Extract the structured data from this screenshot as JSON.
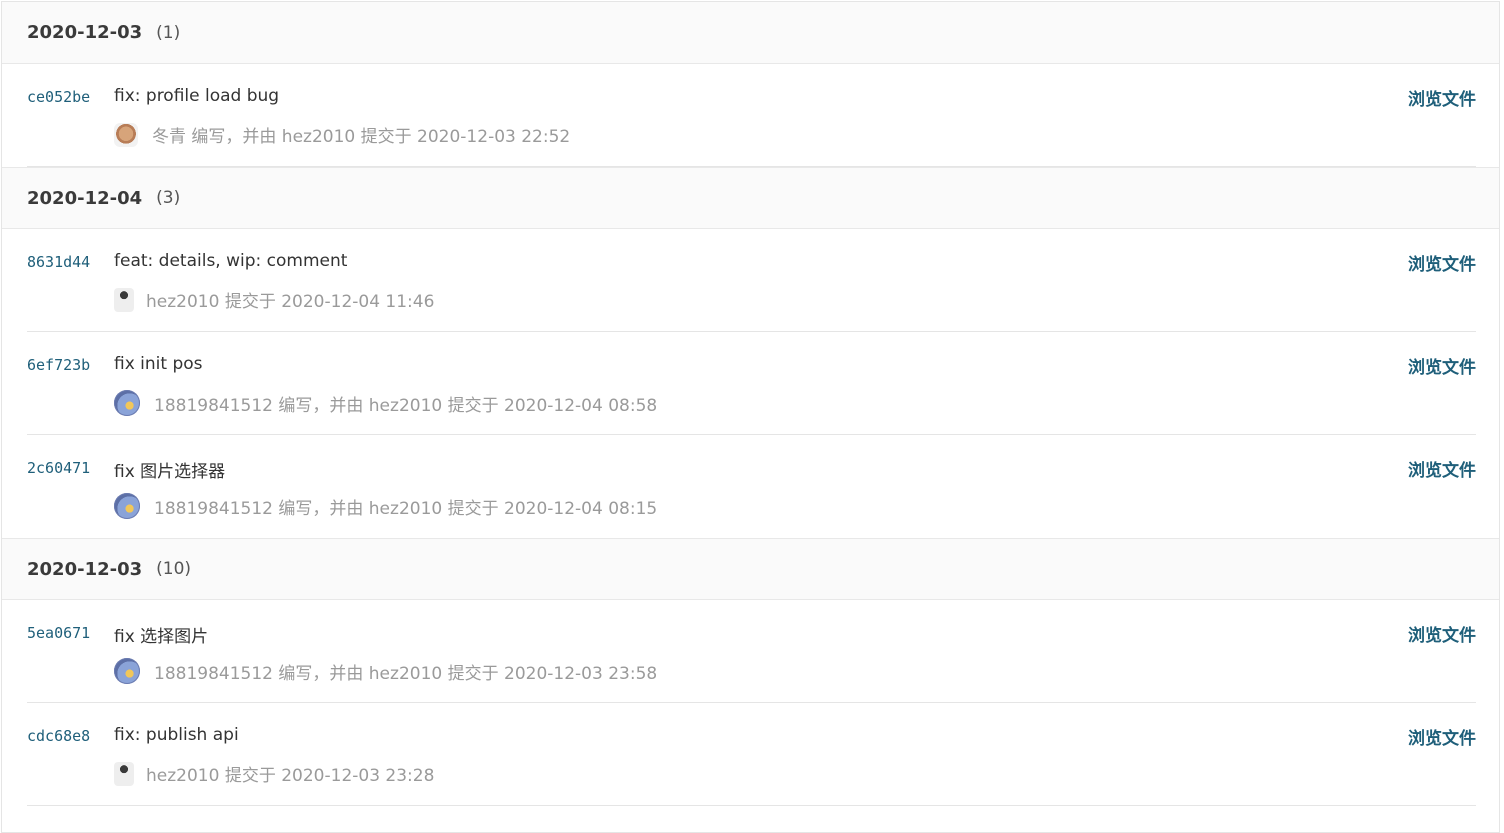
{
  "groups": [
    {
      "date": "2020-12-03",
      "count": "(1)",
      "commits": [
        {
          "sha": "ce052be",
          "message": "fix: profile load bug",
          "meta": "冬青 编写，并由 hez2010 提交于 2020-12-03 22:52",
          "avatar": "bear-avatar",
          "action": "浏览文件"
        }
      ]
    },
    {
      "date": "2020-12-04",
      "count": "(3)",
      "commits": [
        {
          "sha": "8631d44",
          "message": "feat: details, wip: comment",
          "meta": "hez2010 提交于 2020-12-04 11:46",
          "avatar": "person-avatar",
          "action": "浏览文件"
        },
        {
          "sha": "6ef723b",
          "message": "fix init pos",
          "meta": "18819841512 编写，并由 hez2010 提交于 2020-12-04 08:58",
          "avatar": "globe-avatar",
          "action": "浏览文件"
        },
        {
          "sha": "2c60471",
          "message": "fix 图片选择器",
          "meta": "18819841512 编写，并由 hez2010 提交于 2020-12-04 08:15",
          "avatar": "globe-avatar",
          "action": "浏览文件"
        }
      ]
    },
    {
      "date": "2020-12-03",
      "count": "(10)",
      "commits": [
        {
          "sha": "5ea0671",
          "message": "fix 选择图片",
          "meta": "18819841512 编写，并由 hez2010 提交于 2020-12-03 23:58",
          "avatar": "globe-avatar",
          "action": "浏览文件"
        },
        {
          "sha": "cdc68e8",
          "message": "fix: publish api",
          "meta": "hez2010 提交于 2020-12-03 23:28",
          "avatar": "person-avatar",
          "action": "浏览文件"
        }
      ]
    }
  ],
  "colors": {
    "link": "#1f5f7a",
    "header_bg": "#fafafa",
    "meta_text": "#9a9a9a"
  }
}
